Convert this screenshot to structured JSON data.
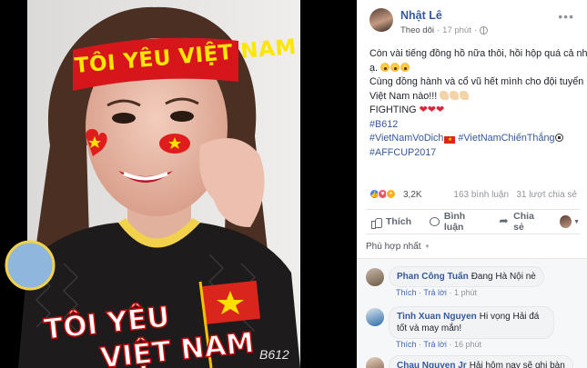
{
  "photo": {
    "headband_text": "TÔI YÊU VIỆT NAM",
    "sticker_line1": "TÔI YÊU",
    "sticker_line2": "VIỆT NAM",
    "watermark": "B612"
  },
  "post": {
    "author": "Nhật Lê",
    "follow_label": "Theo dõi",
    "time": "17 phút",
    "more_label": "•••",
    "lines": [
      "Còn vài tiếng đồng hồ nữa thôi, hồi hộp quá cả nhà",
      "ạ.",
      "Cùng đồng hành và cổ vũ hết mình cho đội tuyển",
      "Việt Nam nào!!!",
      "FIGHTING"
    ],
    "hashtags": [
      "#B612",
      "#VietNamVoDich",
      "#VietNamChiếnThắng",
      "#AFFCUP2017"
    ]
  },
  "reactions": {
    "count": "3,2K",
    "comments": "163 bình luận",
    "shares": "31 lượt chia sẻ"
  },
  "actions": {
    "like": "Thích",
    "comment": "Bình luận",
    "share": "Chia sẻ"
  },
  "sort": {
    "label": "Phù hợp nhất"
  },
  "comments": [
    {
      "author": "Phan Công Tuấn",
      "text": "Đang Hà Nội nè",
      "like": "Thích",
      "reply": "Trả lời",
      "time": "1 phút"
    },
    {
      "author": "Tình Xuan Nguyen",
      "text": "Hi vọng Hải đá tốt và may mắn!",
      "like": "Thích",
      "reply": "Trả lời",
      "time": "16 phút"
    },
    {
      "author": "Chau Nguyen Jr",
      "text": "Hải hôm nay sẽ ghi bàn"
    }
  ],
  "colors": {
    "link": "#365899",
    "accent_red": "#da251d",
    "star_yellow": "#ffde00"
  }
}
